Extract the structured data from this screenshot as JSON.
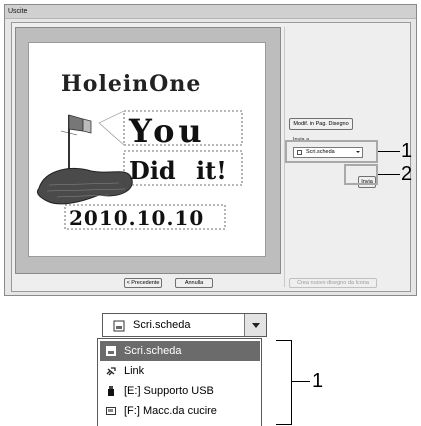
{
  "window": {
    "title": "Uscite"
  },
  "preview": {
    "line1": "HoleinOne",
    "line2": "You",
    "line3": "Did",
    "line4": "it!",
    "line5": "2010.10.10"
  },
  "right_panel": {
    "modify_button": "Modif. in Pag. Disegno",
    "send_to_label": "Invia a",
    "destination_value": "Scri.scheda",
    "send_button": "Invia"
  },
  "footer": {
    "prev_button": "< Precedente",
    "cancel_button": "Annulla",
    "new_design_button": "Crea nuovo disegno da Icona"
  },
  "callouts": {
    "one": "1",
    "two": "2",
    "one_bottom": "1"
  },
  "dropdown": {
    "selected": "Scri.scheda",
    "options": [
      {
        "label": "Scri.scheda",
        "icon": "card-writer-icon",
        "selected": true
      },
      {
        "label": "Link",
        "icon": "link-icon",
        "selected": false
      },
      {
        "label": "[E:] Supporto USB",
        "icon": "usb-icon",
        "selected": false
      },
      {
        "label": "[F:] Macc.da cucire",
        "icon": "sewing-machine-icon",
        "selected": false
      }
    ]
  }
}
